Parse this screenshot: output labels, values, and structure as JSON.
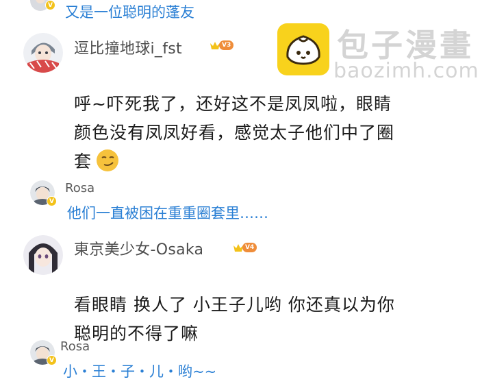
{
  "thread": {
    "top_reply": {
      "text": "又是一位聪明的蓬友"
    },
    "comment1": {
      "username": "逗比撞地球i_fst",
      "level": "V3",
      "lines": [
        "呼~吓死我了，还好这不是凤凤啦，眼睛",
        "颜色没有凤凤好看，感觉太子他们中了圈",
        "套"
      ],
      "emoji": "smirk-emoji",
      "reply": {
        "username": "Rosa",
        "text": "他们一直被困在重重圈套里……"
      }
    },
    "comment2": {
      "username": "東京美少女-Osaka",
      "level": "V4",
      "lines": [
        "看眼睛 换人了 小王子儿哟 你还真以为你",
        "聪明的不得了嘛"
      ],
      "reply": {
        "username": "Rosa",
        "text": "小・王・子・儿・哟~~"
      }
    },
    "verified_mark": "V"
  },
  "watermark": {
    "title": "包子漫畫",
    "url": "baozimh.com"
  },
  "colors": {
    "reply_blue": "#2a7fd4",
    "level_orange": "#ef8d3a",
    "badge_yellow": "#f3c21a",
    "logo_yellow": "#f8d21c"
  }
}
